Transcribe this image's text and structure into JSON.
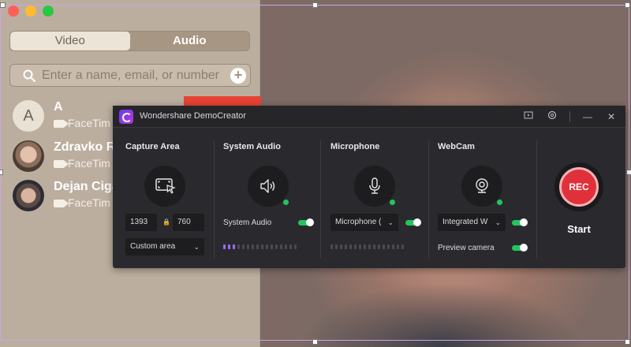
{
  "facetime": {
    "tabs": [
      {
        "label": "Video"
      },
      {
        "label": "Audio"
      }
    ],
    "search": {
      "placeholder": "Enter a name, email, or number"
    },
    "contacts": [
      {
        "initial": "A",
        "name": "A",
        "sub": "FaceTim"
      },
      {
        "name": "Zdravko Ra",
        "sub": "FaceTim"
      },
      {
        "name": "Dejan Ciga",
        "sub": "FaceTim"
      }
    ]
  },
  "democreator": {
    "title": "Wondershare DemoCreator",
    "capture": {
      "title": "Capture Area",
      "width": "1393",
      "height": "760",
      "mode": "Custom area"
    },
    "system_audio": {
      "title": "System Audio",
      "toggle_label": "System Audio",
      "enabled": true,
      "level": 0.2
    },
    "microphone": {
      "title": "Microphone",
      "device": "Microphone (",
      "enabled": true,
      "level": 0
    },
    "webcam": {
      "title": "WebCam",
      "device": "Integrated W",
      "enabled": true,
      "preview_label": "Preview camera",
      "preview_enabled": true
    },
    "rec": {
      "label": "REC",
      "start_label": "Start"
    }
  },
  "colors": {
    "accent": "#22c55e",
    "rec_red": "#e0313a",
    "meter_active": "#9b6cf0"
  }
}
